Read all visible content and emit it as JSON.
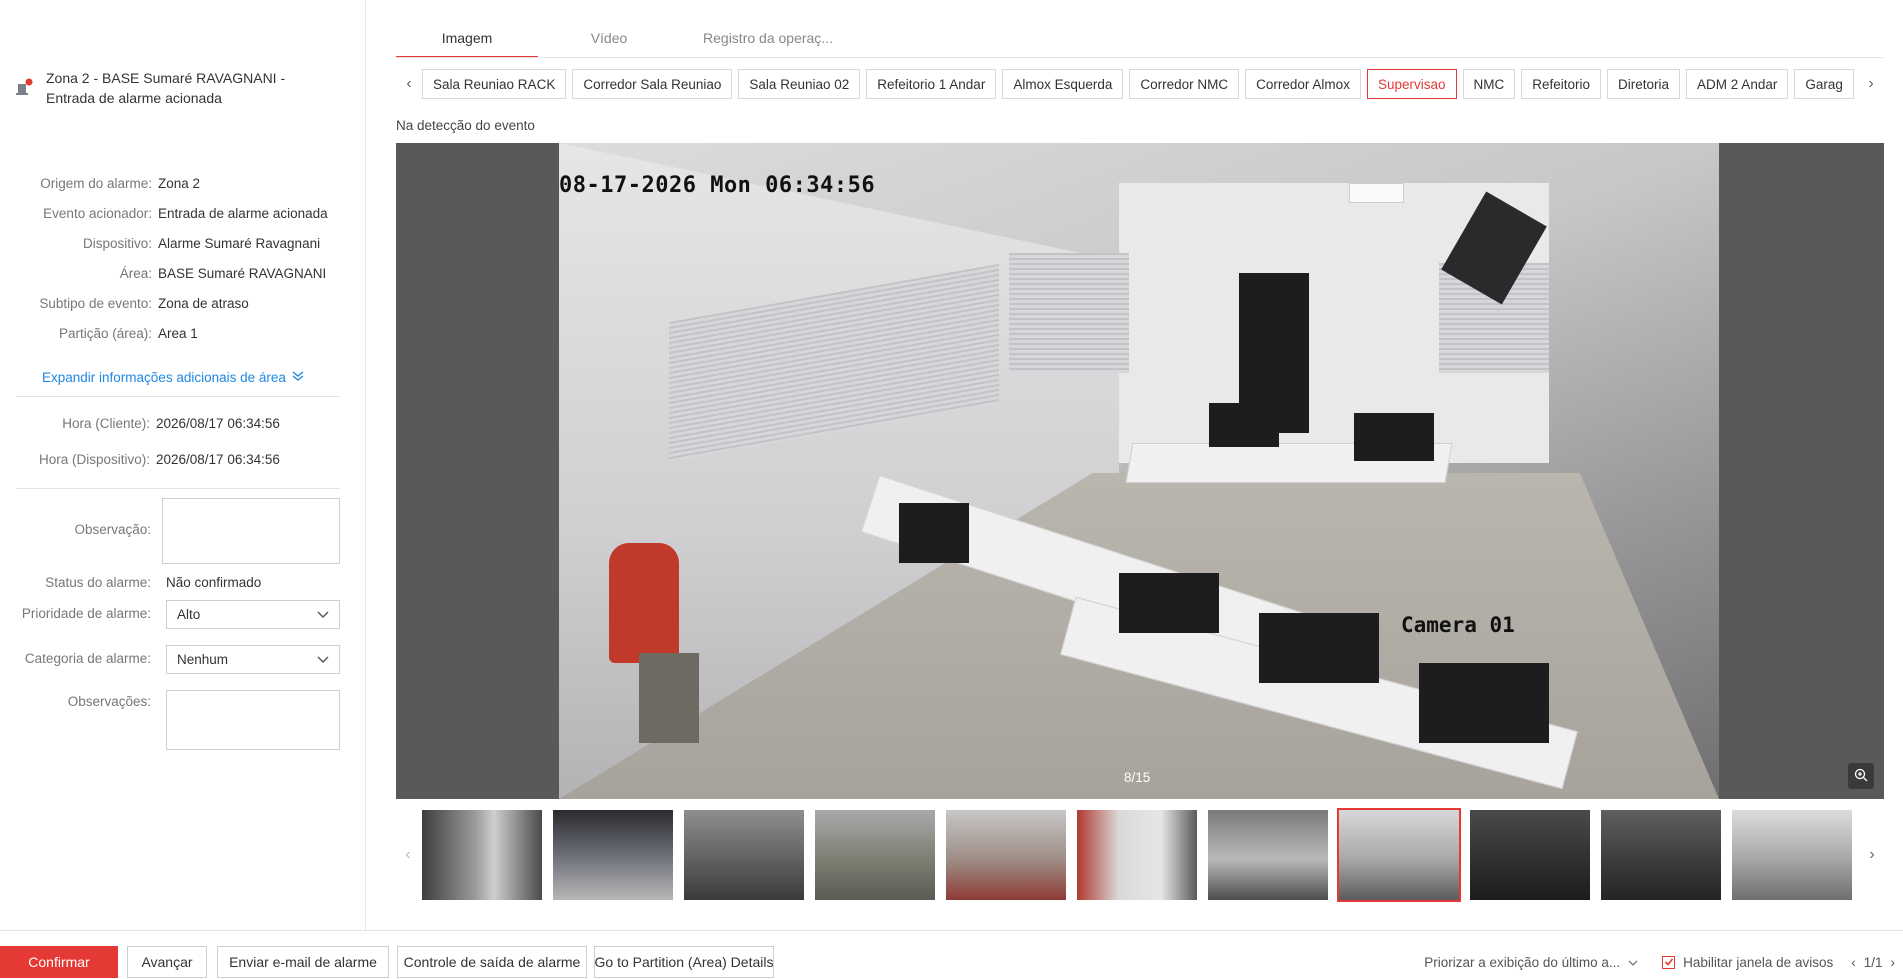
{
  "alarm": {
    "title": "Zona 2 - BASE Sumaré RAVAGNANI - Entrada de alarme acionada"
  },
  "info": [
    {
      "label": "Origem do alarme:",
      "value": "Zona 2"
    },
    {
      "label": "Evento acionador:",
      "value": "Entrada de alarme acionada"
    },
    {
      "label": "Dispositivo:",
      "value": "Alarme Sumaré Ravagnani"
    },
    {
      "label": "Área:",
      "value": "BASE Sumaré RAVAGNANI"
    },
    {
      "label": "Subtipo de evento:",
      "value": "Zona de atraso"
    },
    {
      "label": "Partição (área):",
      "value": "Area 1"
    }
  ],
  "expand_link": "Expandir informações adicionais de área",
  "times": {
    "client_label": "Hora (Cliente):",
    "client_value": "2026/08/17 06:34:56",
    "device_label": "Hora (Dispositivo):",
    "device_value": "2026/08/17 06:34:56"
  },
  "form": {
    "observation_label": "Observação:",
    "status_label": "Status do alarme:",
    "status_value": "Não confirmado",
    "priority_label": "Prioridade de alarme:",
    "priority_value": "Alto",
    "category_label": "Categoria de alarme:",
    "category_value": "Nenhum",
    "remarks_label": "Observações:"
  },
  "tabs": [
    "Imagem",
    "Vídeo",
    "Registro da operaç..."
  ],
  "cameras": [
    "Sala Reuniao RACK",
    "Corredor Sala Reuniao",
    "Sala Reuniao 02",
    "Refeitorio 1 Andar",
    "Almox Esquerda",
    "Corredor NMC",
    "Corredor Almox",
    "Supervisao",
    "NMC",
    "Refeitorio",
    "Diretoria",
    "ADM 2 Andar",
    "Garag"
  ],
  "active_camera": "Supervisao",
  "event_caption": "Na detecção do evento",
  "image": {
    "timestamp": "08-17-2026 Mon 06:34:56",
    "camera_label": "Camera 01",
    "counter": "8/15"
  },
  "thumbnail_count": 11,
  "active_thumbnail": 8,
  "buttons": {
    "confirm": "Confirmar",
    "next": "Avançar",
    "email": "Enviar e-mail de alarme",
    "output": "Controle de saída de alarme",
    "partition": "Go to Partition (Area) Details"
  },
  "bottom": {
    "priority_display": "Priorizar a exibição do último a...",
    "enable_window": "Habilitar janela de avisos",
    "pager": "1/1"
  },
  "colors": {
    "accent": "#e53935",
    "link": "#1e88e5"
  }
}
